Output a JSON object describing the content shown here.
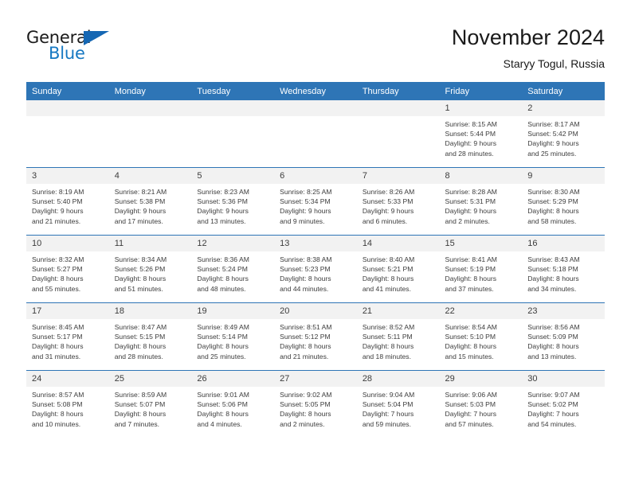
{
  "brand": {
    "name_top": "General",
    "name_bottom": "Blue",
    "triangle_color": "#1567b3",
    "blue_color": "#1678c2"
  },
  "header": {
    "title": "November 2024",
    "subtitle": "Staryy Togul, Russia"
  },
  "theme": {
    "header_band": "#2e75b6",
    "daynum_band": "#f2f2f2",
    "text": "#3c3c3c"
  },
  "weekday_headers": [
    "Sunday",
    "Monday",
    "Tuesday",
    "Wednesday",
    "Thursday",
    "Friday",
    "Saturday"
  ],
  "labels": {
    "sunrise": "Sunrise:",
    "sunset": "Sunset:",
    "daylight": "Daylight:"
  },
  "weeks": [
    [
      {
        "day": "",
        "blank": true
      },
      {
        "day": "",
        "blank": true
      },
      {
        "day": "",
        "blank": true
      },
      {
        "day": "",
        "blank": true
      },
      {
        "day": "",
        "blank": true
      },
      {
        "day": "1",
        "sunrise": "Sunrise: 8:15 AM",
        "sunset": "Sunset: 5:44 PM",
        "daylight1": "Daylight: 9 hours",
        "daylight2": "and 28 minutes."
      },
      {
        "day": "2",
        "sunrise": "Sunrise: 8:17 AM",
        "sunset": "Sunset: 5:42 PM",
        "daylight1": "Daylight: 9 hours",
        "daylight2": "and 25 minutes."
      }
    ],
    [
      {
        "day": "3",
        "sunrise": "Sunrise: 8:19 AM",
        "sunset": "Sunset: 5:40 PM",
        "daylight1": "Daylight: 9 hours",
        "daylight2": "and 21 minutes."
      },
      {
        "day": "4",
        "sunrise": "Sunrise: 8:21 AM",
        "sunset": "Sunset: 5:38 PM",
        "daylight1": "Daylight: 9 hours",
        "daylight2": "and 17 minutes."
      },
      {
        "day": "5",
        "sunrise": "Sunrise: 8:23 AM",
        "sunset": "Sunset: 5:36 PM",
        "daylight1": "Daylight: 9 hours",
        "daylight2": "and 13 minutes."
      },
      {
        "day": "6",
        "sunrise": "Sunrise: 8:25 AM",
        "sunset": "Sunset: 5:34 PM",
        "daylight1": "Daylight: 9 hours",
        "daylight2": "and 9 minutes."
      },
      {
        "day": "7",
        "sunrise": "Sunrise: 8:26 AM",
        "sunset": "Sunset: 5:33 PM",
        "daylight1": "Daylight: 9 hours",
        "daylight2": "and 6 minutes."
      },
      {
        "day": "8",
        "sunrise": "Sunrise: 8:28 AM",
        "sunset": "Sunset: 5:31 PM",
        "daylight1": "Daylight: 9 hours",
        "daylight2": "and 2 minutes."
      },
      {
        "day": "9",
        "sunrise": "Sunrise: 8:30 AM",
        "sunset": "Sunset: 5:29 PM",
        "daylight1": "Daylight: 8 hours",
        "daylight2": "and 58 minutes."
      }
    ],
    [
      {
        "day": "10",
        "sunrise": "Sunrise: 8:32 AM",
        "sunset": "Sunset: 5:27 PM",
        "daylight1": "Daylight: 8 hours",
        "daylight2": "and 55 minutes."
      },
      {
        "day": "11",
        "sunrise": "Sunrise: 8:34 AM",
        "sunset": "Sunset: 5:26 PM",
        "daylight1": "Daylight: 8 hours",
        "daylight2": "and 51 minutes."
      },
      {
        "day": "12",
        "sunrise": "Sunrise: 8:36 AM",
        "sunset": "Sunset: 5:24 PM",
        "daylight1": "Daylight: 8 hours",
        "daylight2": "and 48 minutes."
      },
      {
        "day": "13",
        "sunrise": "Sunrise: 8:38 AM",
        "sunset": "Sunset: 5:23 PM",
        "daylight1": "Daylight: 8 hours",
        "daylight2": "and 44 minutes."
      },
      {
        "day": "14",
        "sunrise": "Sunrise: 8:40 AM",
        "sunset": "Sunset: 5:21 PM",
        "daylight1": "Daylight: 8 hours",
        "daylight2": "and 41 minutes."
      },
      {
        "day": "15",
        "sunrise": "Sunrise: 8:41 AM",
        "sunset": "Sunset: 5:19 PM",
        "daylight1": "Daylight: 8 hours",
        "daylight2": "and 37 minutes."
      },
      {
        "day": "16",
        "sunrise": "Sunrise: 8:43 AM",
        "sunset": "Sunset: 5:18 PM",
        "daylight1": "Daylight: 8 hours",
        "daylight2": "and 34 minutes."
      }
    ],
    [
      {
        "day": "17",
        "sunrise": "Sunrise: 8:45 AM",
        "sunset": "Sunset: 5:17 PM",
        "daylight1": "Daylight: 8 hours",
        "daylight2": "and 31 minutes."
      },
      {
        "day": "18",
        "sunrise": "Sunrise: 8:47 AM",
        "sunset": "Sunset: 5:15 PM",
        "daylight1": "Daylight: 8 hours",
        "daylight2": "and 28 minutes."
      },
      {
        "day": "19",
        "sunrise": "Sunrise: 8:49 AM",
        "sunset": "Sunset: 5:14 PM",
        "daylight1": "Daylight: 8 hours",
        "daylight2": "and 25 minutes."
      },
      {
        "day": "20",
        "sunrise": "Sunrise: 8:51 AM",
        "sunset": "Sunset: 5:12 PM",
        "daylight1": "Daylight: 8 hours",
        "daylight2": "and 21 minutes."
      },
      {
        "day": "21",
        "sunrise": "Sunrise: 8:52 AM",
        "sunset": "Sunset: 5:11 PM",
        "daylight1": "Daylight: 8 hours",
        "daylight2": "and 18 minutes."
      },
      {
        "day": "22",
        "sunrise": "Sunrise: 8:54 AM",
        "sunset": "Sunset: 5:10 PM",
        "daylight1": "Daylight: 8 hours",
        "daylight2": "and 15 minutes."
      },
      {
        "day": "23",
        "sunrise": "Sunrise: 8:56 AM",
        "sunset": "Sunset: 5:09 PM",
        "daylight1": "Daylight: 8 hours",
        "daylight2": "and 13 minutes."
      }
    ],
    [
      {
        "day": "24",
        "sunrise": "Sunrise: 8:57 AM",
        "sunset": "Sunset: 5:08 PM",
        "daylight1": "Daylight: 8 hours",
        "daylight2": "and 10 minutes."
      },
      {
        "day": "25",
        "sunrise": "Sunrise: 8:59 AM",
        "sunset": "Sunset: 5:07 PM",
        "daylight1": "Daylight: 8 hours",
        "daylight2": "and 7 minutes."
      },
      {
        "day": "26",
        "sunrise": "Sunrise: 9:01 AM",
        "sunset": "Sunset: 5:06 PM",
        "daylight1": "Daylight: 8 hours",
        "daylight2": "and 4 minutes."
      },
      {
        "day": "27",
        "sunrise": "Sunrise: 9:02 AM",
        "sunset": "Sunset: 5:05 PM",
        "daylight1": "Daylight: 8 hours",
        "daylight2": "and 2 minutes."
      },
      {
        "day": "28",
        "sunrise": "Sunrise: 9:04 AM",
        "sunset": "Sunset: 5:04 PM",
        "daylight1": "Daylight: 7 hours",
        "daylight2": "and 59 minutes."
      },
      {
        "day": "29",
        "sunrise": "Sunrise: 9:06 AM",
        "sunset": "Sunset: 5:03 PM",
        "daylight1": "Daylight: 7 hours",
        "daylight2": "and 57 minutes."
      },
      {
        "day": "30",
        "sunrise": "Sunrise: 9:07 AM",
        "sunset": "Sunset: 5:02 PM",
        "daylight1": "Daylight: 7 hours",
        "daylight2": "and 54 minutes."
      }
    ]
  ]
}
